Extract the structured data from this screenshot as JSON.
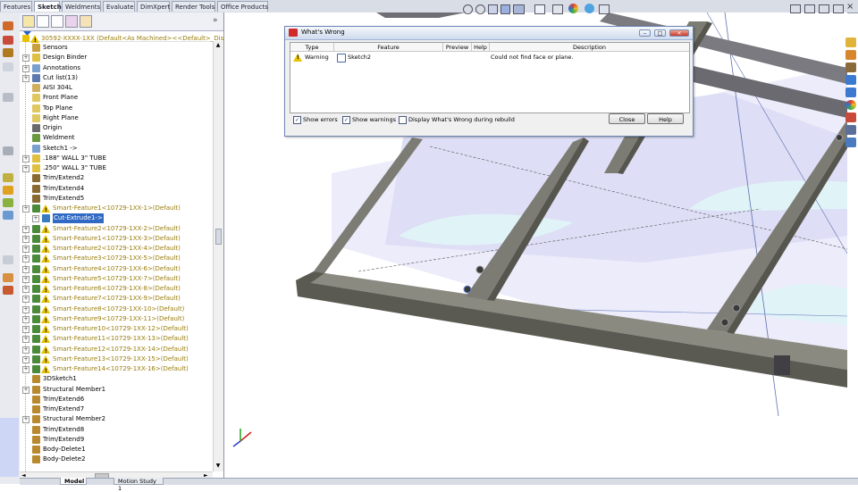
{
  "command_tabs": [
    "Features",
    "Sketch",
    "Weldments",
    "Evaluate",
    "DimXpert",
    "Render Tools",
    "Office Products"
  ],
  "command_tabs_active": "Sketch",
  "tree": {
    "root": "30592-XXXX-1XX (Default<As Machined><<Default>_Displ",
    "items": [
      {
        "label": "Sensors",
        "indent": 1,
        "expand": false,
        "warn": false
      },
      {
        "label": "Design Binder",
        "indent": 1,
        "expand": true,
        "warn": false
      },
      {
        "label": "Annotations",
        "indent": 1,
        "expand": true,
        "warn": false
      },
      {
        "label": "Cut list(13)",
        "indent": 1,
        "expand": true,
        "warn": false
      },
      {
        "label": "AISI 304L",
        "indent": 1,
        "expand": false,
        "warn": false
      },
      {
        "label": "Front Plane",
        "indent": 1,
        "expand": false,
        "warn": false
      },
      {
        "label": "Top Plane",
        "indent": 1,
        "expand": false,
        "warn": false
      },
      {
        "label": "Right Plane",
        "indent": 1,
        "expand": false,
        "warn": false
      },
      {
        "label": "Origin",
        "indent": 1,
        "expand": false,
        "warn": false
      },
      {
        "label": "Weldment",
        "indent": 1,
        "expand": false,
        "warn": false
      },
      {
        "label": "Sketch1 ->",
        "indent": 1,
        "expand": false,
        "warn": false
      },
      {
        "label": ".188\" WALL 3\" TUBE",
        "indent": 1,
        "expand": true,
        "warn": false
      },
      {
        "label": ".250\" WALL 3\" TUBE",
        "indent": 1,
        "expand": true,
        "warn": false
      },
      {
        "label": "Trim/Extend2",
        "indent": 1,
        "expand": false,
        "warn": false
      },
      {
        "label": "Trim/Extend4",
        "indent": 1,
        "expand": false,
        "warn": false
      },
      {
        "label": "Trim/Extend5",
        "indent": 1,
        "expand": false,
        "warn": false
      },
      {
        "label": "Smart-Feature1<10729-1XX-1>(Default)",
        "indent": 1,
        "expand": true,
        "warn": true
      },
      {
        "label": "Cut-Extrude1->",
        "indent": 2,
        "expand": true,
        "warn": false,
        "selected": true
      },
      {
        "label": "Smart-Feature2<10729-1XX-2>(Default)",
        "indent": 1,
        "expand": true,
        "warn": true
      },
      {
        "label": "Smart-Feature1<10729-1XX-3>(Default)",
        "indent": 1,
        "expand": true,
        "warn": true
      },
      {
        "label": "Smart-Feature2<10729-1XX-4>(Default)",
        "indent": 1,
        "expand": true,
        "warn": true
      },
      {
        "label": "Smart-Feature3<10729-1XX-5>(Default)",
        "indent": 1,
        "expand": true,
        "warn": true
      },
      {
        "label": "Smart-Feature4<10729-1XX-6>(Default)",
        "indent": 1,
        "expand": true,
        "warn": true
      },
      {
        "label": "Smart-Feature5<10729-1XX-7>(Default)",
        "indent": 1,
        "expand": true,
        "warn": true
      },
      {
        "label": "Smart-Feature6<10729-1XX-8>(Default)",
        "indent": 1,
        "expand": true,
        "warn": true
      },
      {
        "label": "Smart-Feature7<10729-1XX-9>(Default)",
        "indent": 1,
        "expand": true,
        "warn": true
      },
      {
        "label": "Smart-Feature8<10729-1XX-10>(Default)",
        "indent": 1,
        "expand": true,
        "warn": true
      },
      {
        "label": "Smart-Feature9<10729-1XX-11>(Default)",
        "indent": 1,
        "expand": true,
        "warn": true
      },
      {
        "label": "Smart-Feature10<10729-1XX-12>(Default)",
        "indent": 1,
        "expand": true,
        "warn": true
      },
      {
        "label": "Smart-Feature11<10729-1XX-13>(Default)",
        "indent": 1,
        "expand": true,
        "warn": true
      },
      {
        "label": "Smart-Feature12<10729-1XX-14>(Default)",
        "indent": 1,
        "expand": true,
        "warn": true
      },
      {
        "label": "Smart-Feature13<10729-1XX-15>(Default)",
        "indent": 1,
        "expand": true,
        "warn": true
      },
      {
        "label": "Smart-Feature14<10729-1XX-16>(Default)",
        "indent": 1,
        "expand": true,
        "warn": true
      },
      {
        "label": "3DSketch1",
        "indent": 1,
        "expand": false,
        "warn": false
      },
      {
        "label": "Structural Member1",
        "indent": 1,
        "expand": true,
        "warn": false
      },
      {
        "label": "Trim/Extend6",
        "indent": 1,
        "expand": false,
        "warn": false
      },
      {
        "label": "Trim/Extend7",
        "indent": 1,
        "expand": false,
        "warn": false
      },
      {
        "label": "Structural Member2",
        "indent": 1,
        "expand": true,
        "warn": false
      },
      {
        "label": "Trim/Extend8",
        "indent": 1,
        "expand": false,
        "warn": false
      },
      {
        "label": "Trim/Extend9",
        "indent": 1,
        "expand": false,
        "warn": false
      },
      {
        "label": "Body-Delete1",
        "indent": 1,
        "expand": false,
        "warn": false
      },
      {
        "label": "Body-Delete2",
        "indent": 1,
        "expand": false,
        "warn": false
      }
    ]
  },
  "bottom_tabs": [
    "Model",
    "Motion Study 1"
  ],
  "bottom_tabs_active": "Model",
  "dialog": {
    "title": "What's Wrong",
    "columns": [
      "Type",
      "Feature",
      "Preview",
      "Help",
      "Description"
    ],
    "row": {
      "type": "Warning",
      "feature": "Sketch2",
      "preview": "",
      "help": "",
      "description": "Could not find face or plane."
    },
    "show_errors_label": "Show errors",
    "show_errors_checked": true,
    "show_warnings_label": "Show warnings",
    "show_warnings_checked": true,
    "display_rebuild_label": "Display What's Wrong during rebuild",
    "display_rebuild_checked": false,
    "close_label": "Close",
    "help_label": "Help"
  },
  "colors": {
    "frame_top": "#7a7a80",
    "frame_side": "#56565c",
    "warn_text": "#9a7d0a",
    "selection": "#316ac5",
    "plane_fill": "#dcdcf5"
  }
}
